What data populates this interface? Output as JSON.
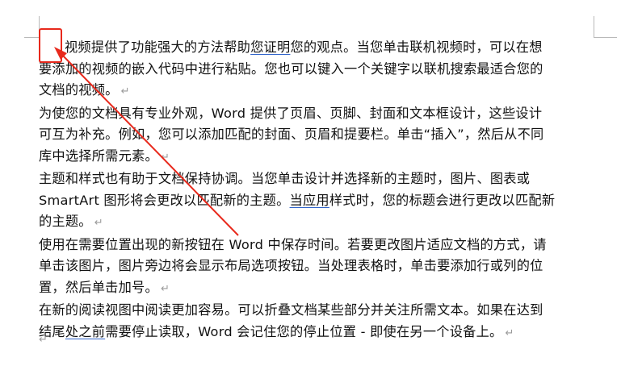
{
  "document": {
    "paragraphs": [
      {
        "lines": [
          [
            {
              "text": "视频提供了功能强大的方法帮助"
            },
            {
              "text": "您证明",
              "u": true
            },
            {
              "text": "您的观点。当您单击联机视频时，可以在想"
            }
          ],
          [
            {
              "text": "要添加的视频的嵌入代码中进行粘贴。您也可以键入一个关键字以联机搜索最适合您的"
            }
          ],
          [
            {
              "text": "文档的视频。"
            }
          ]
        ]
      },
      {
        "lines": [
          [
            {
              "text": "为使您的文档具有专业外观，Word 提供了页眉、页脚、封面和文本框设计，这些设计"
            }
          ],
          [
            {
              "text": "可互为补充。例如，您可以添加匹配的封面、页眉和提要栏。单击“插入”，然后从不同"
            }
          ],
          [
            {
              "text": "库中选择所需元素。"
            }
          ]
        ]
      },
      {
        "lines": [
          [
            {
              "text": "主题和样式也有助于文档保持协调。当您单击设计并选择新的主题时，图片、图表或"
            }
          ],
          [
            {
              "text": "SmartArt 图形将会更改以匹配新的主题。"
            },
            {
              "text": "当应用",
              "u": true
            },
            {
              "text": "样式时，您的标题会进行更改以匹配新"
            }
          ],
          [
            {
              "text": "的主题。"
            }
          ]
        ]
      },
      {
        "lines": [
          [
            {
              "text": "使用在需要位置出现的新按钮在 Word 中保存时间。若要更改图片适应文档的方式，请"
            }
          ],
          [
            {
              "text": "单击该图片，图片旁边将会显示布局选项按钮。当处理表格时，单击要添加行或列的位"
            }
          ],
          [
            {
              "text": "置，然后单击加号。"
            }
          ]
        ]
      },
      {
        "lines": [
          [
            {
              "text": "在新的阅读视图中阅读更加容易。可以折叠文档某些部分并关注所需文本。如果在达到"
            }
          ],
          [
            {
              "text": "结尾"
            },
            {
              "text": "处之前",
              "u": true
            },
            {
              "text": "需要停止读取，Word 会记住您的停止位置 - 即使在另一个设备上。"
            }
          ]
        ]
      }
    ],
    "paragraph_mark": "↵"
  },
  "annotation": {
    "color": "#e8291c"
  }
}
